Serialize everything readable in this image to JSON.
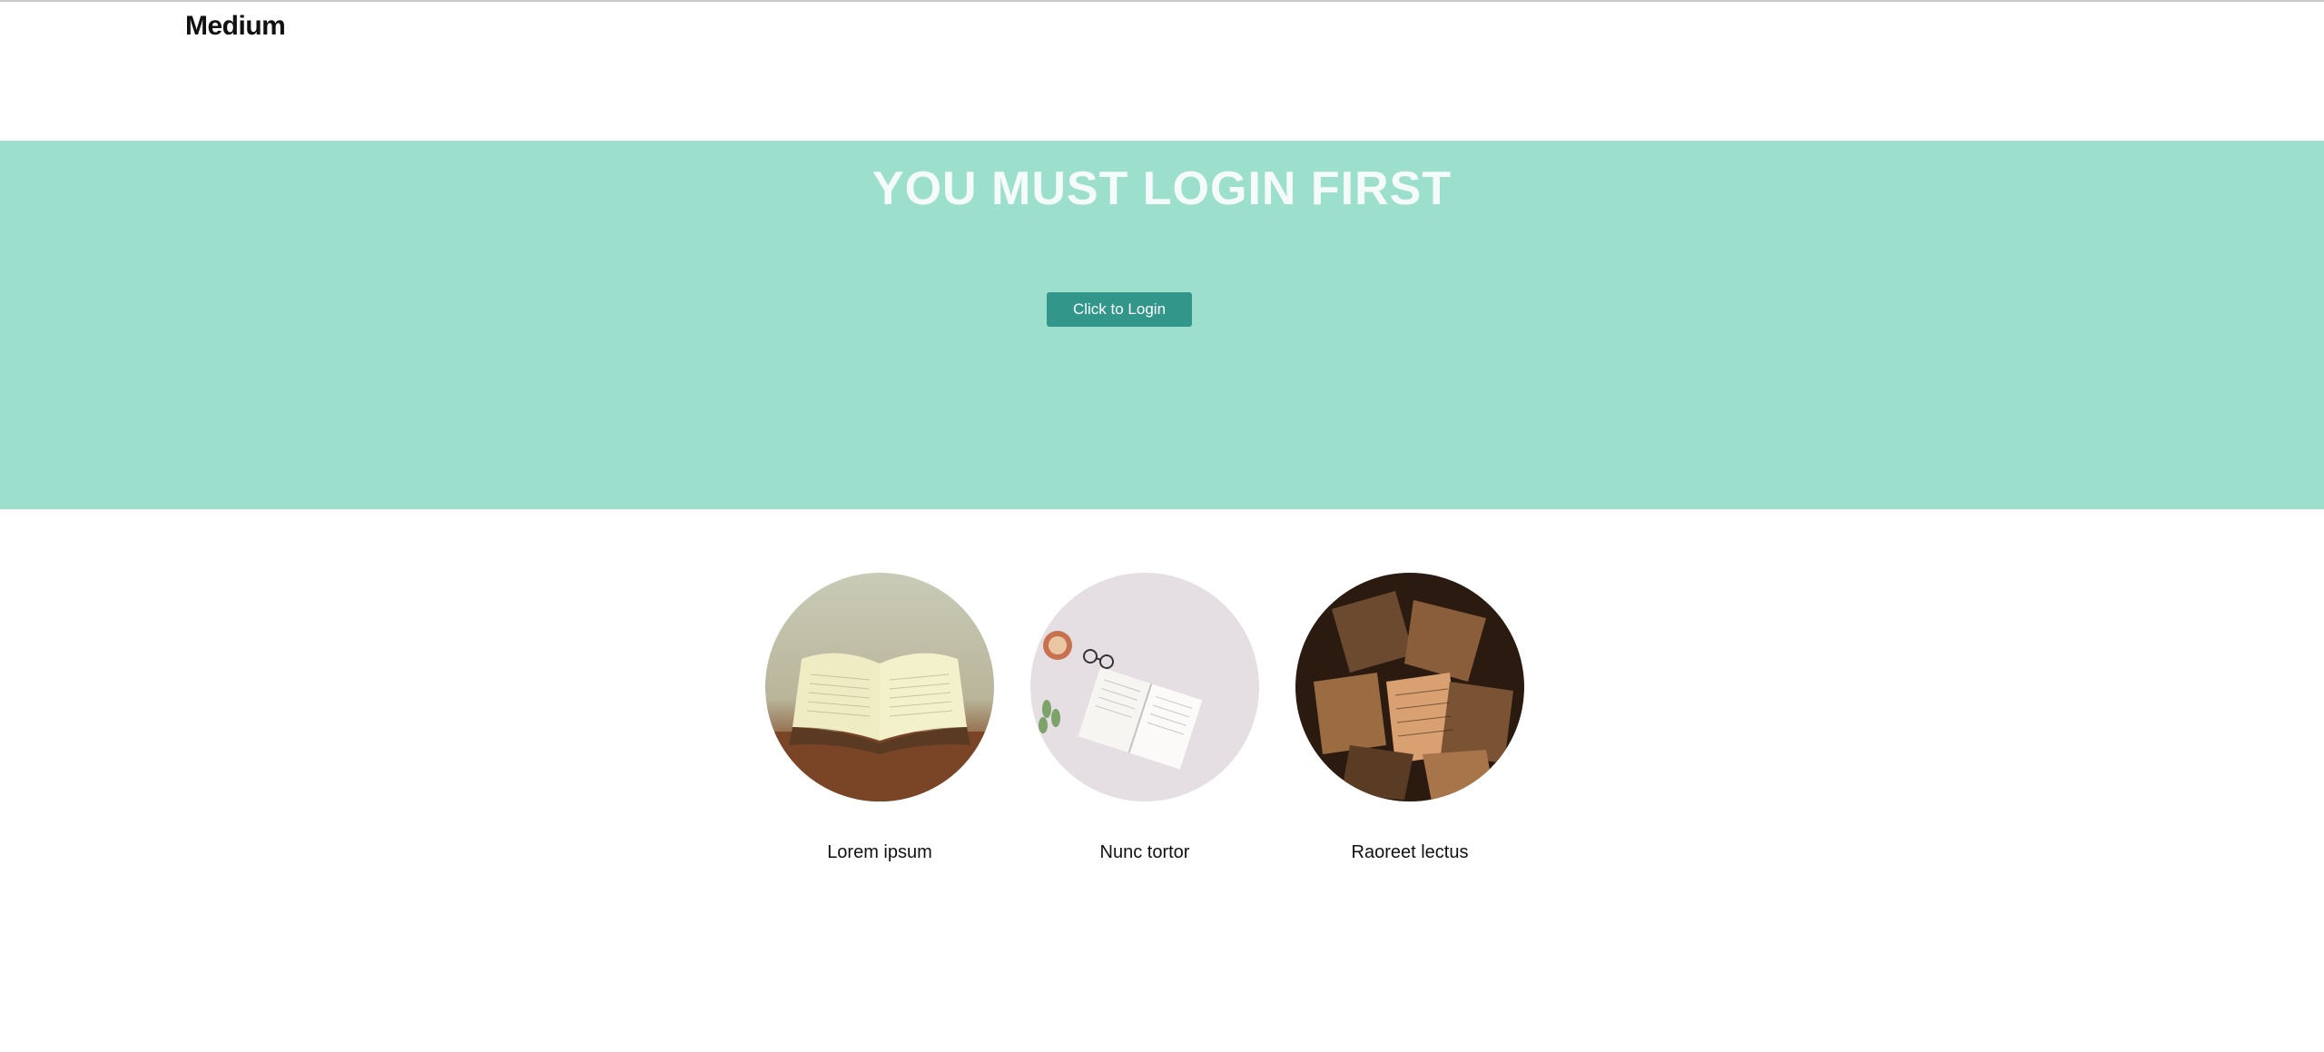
{
  "header": {
    "logo": "Medium"
  },
  "hero": {
    "title": "YOU MUST LOGIN FIRST",
    "login_button_label": "Click to Login"
  },
  "cards": [
    {
      "label": "Lorem ipsum",
      "image": "open-book-photo"
    },
    {
      "label": "Nunc tortor",
      "image": "book-with-glasses-photo"
    },
    {
      "label": "Raoreet lectus",
      "image": "scattered-books-photo"
    }
  ],
  "colors": {
    "hero_background": "#9cdfcd",
    "button_background": "#33968a",
    "hero_title": "#f4fbf8"
  }
}
